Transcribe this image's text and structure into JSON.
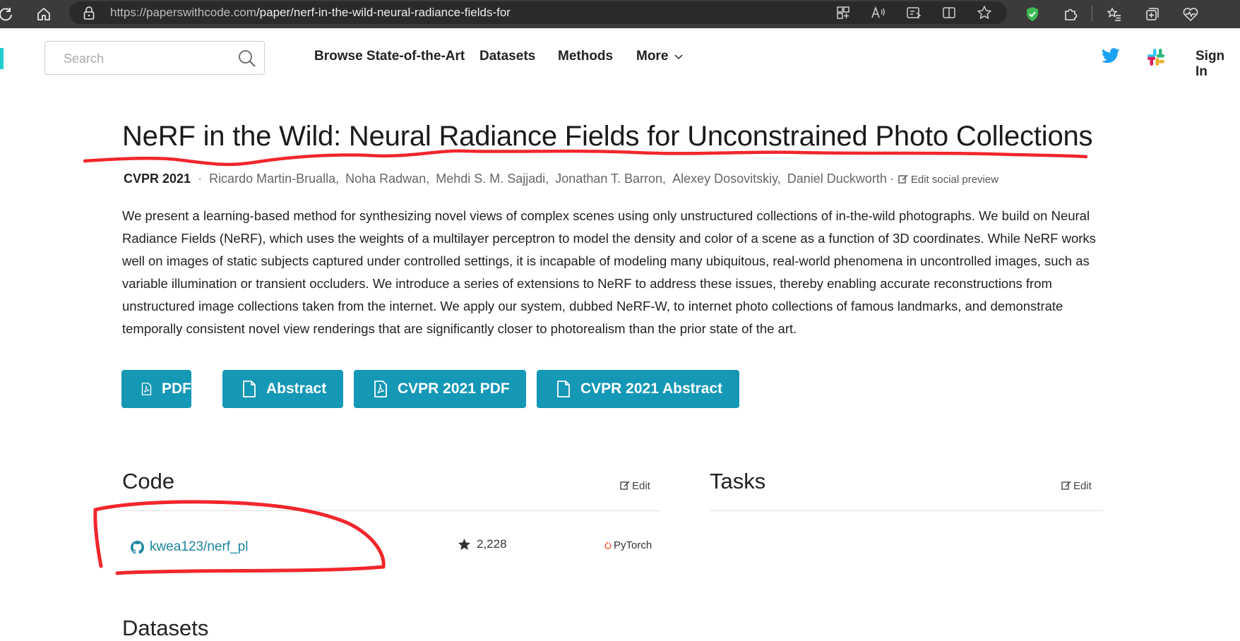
{
  "browser": {
    "url_host": "https://paperswithcode.com",
    "url_path": "/paper/nerf-in-the-wild-neural-radiance-fields-for"
  },
  "navbar": {
    "search_placeholder": "Search",
    "links": [
      "Browse State-of-the-Art",
      "Datasets",
      "Methods",
      "More"
    ],
    "sign_in": "Sign In"
  },
  "paper": {
    "title": "NeRF in the Wild: Neural Radiance Fields for Unconstrained Photo Collections",
    "conference": "CVPR 2021",
    "authors": [
      "Ricardo Martin-Brualla,",
      "Noha Radwan,",
      "Mehdi S. M. Sajjadi,",
      "Jonathan T. Barron,",
      "Alexey Dosovitskiy,",
      "Daniel Duckworth"
    ],
    "edit_social_preview": "Edit social preview",
    "abstract": "We present a learning-based method for synthesizing novel views of complex scenes using only unstructured collections of in-the-wild photographs. We build on Neural Radiance Fields (NeRF), which uses the weights of a multilayer perceptron to model the density and color of a scene as a function of 3D coordinates. While NeRF works well on images of static subjects captured under controlled settings, it is incapable of modeling many ubiquitous, real-world phenomena in uncontrolled images, such as variable illumination or transient occluders. We introduce a series of extensions to NeRF to address these issues, thereby enabling accurate reconstructions from unstructured image collections taken from the internet. We apply our system, dubbed NeRF-W, to internet photo collections of famous landmarks, and demonstrate temporally consistent novel view renderings that are significantly closer to photorealism than the prior state of the art.",
    "buttons": [
      "PDF",
      "Abstract",
      "CVPR 2021 PDF",
      "CVPR 2021 Abstract"
    ]
  },
  "code": {
    "title": "Code",
    "edit": "Edit",
    "repo": "kwea123/nerf_pl",
    "stars": "2,228",
    "framework": "PyTorch"
  },
  "tasks": {
    "title": "Tasks",
    "edit": "Edit"
  },
  "datasets": {
    "title": "Datasets"
  },
  "colors": {
    "accent": "#1597b6",
    "annotation": "#f2262c",
    "chrome": "#3b3b3b"
  }
}
